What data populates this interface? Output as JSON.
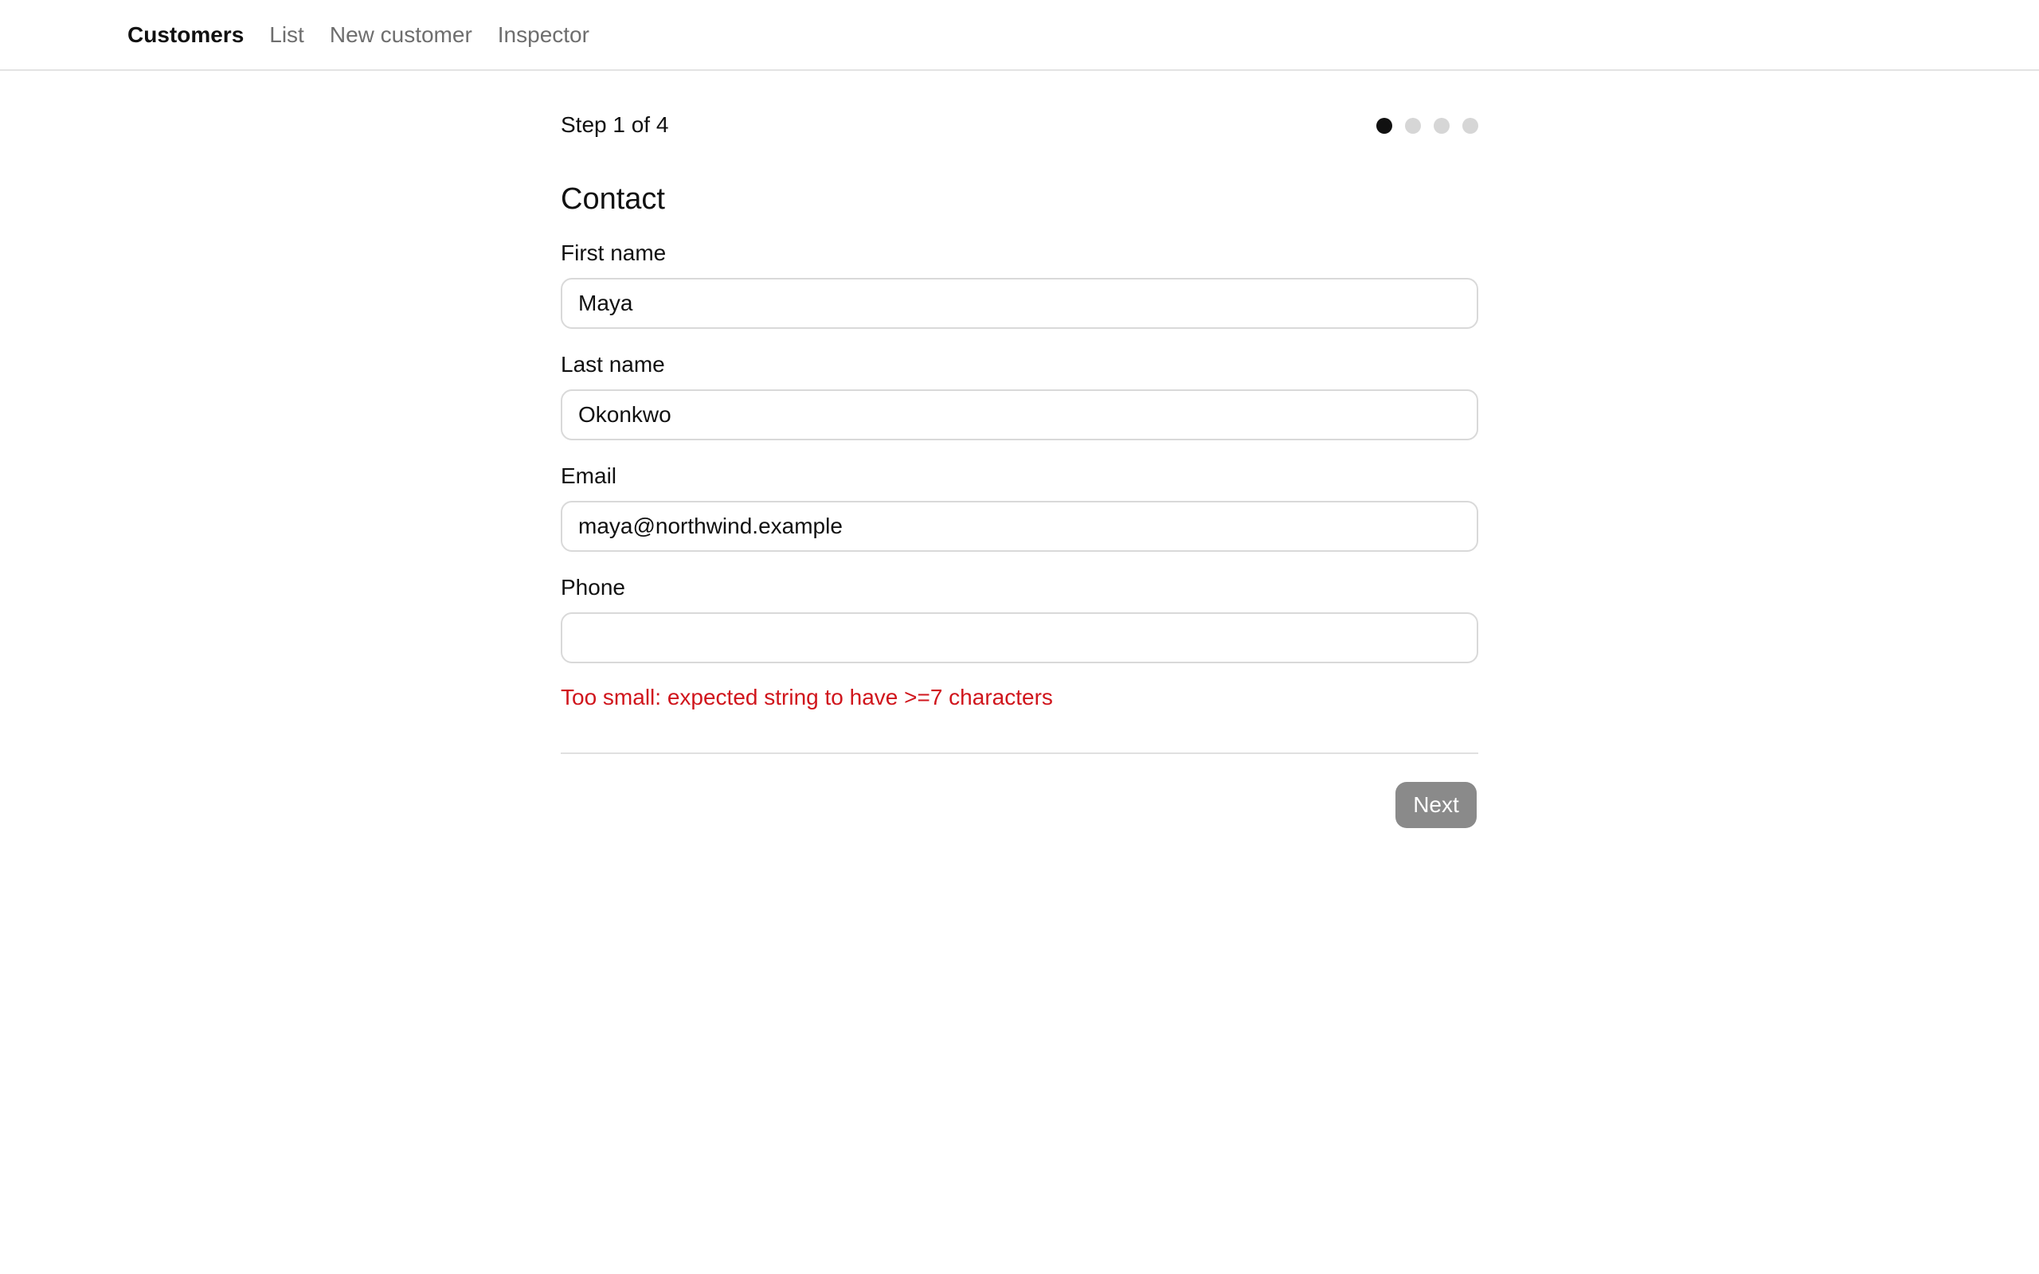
{
  "nav": {
    "brand": "Customers",
    "links": [
      "List",
      "New customer",
      "Inspector"
    ]
  },
  "wizard": {
    "step_label": "Step 1 of 4",
    "steps_total": 4,
    "current_step": 1,
    "section_title": "Contact",
    "fields": {
      "first_name": {
        "label": "First name",
        "value": "Maya"
      },
      "last_name": {
        "label": "Last name",
        "value": "Okonkwo"
      },
      "email": {
        "label": "Email",
        "value": "maya@northwind.example"
      },
      "phone": {
        "label": "Phone",
        "value": ""
      }
    },
    "error": "Too small: expected string to have >=7 characters",
    "next_label": "Next"
  },
  "colors": {
    "error": "#d0151c",
    "dot_active": "#111111",
    "dot_inactive": "#d6d6d6",
    "button_disabled": "#8a8a8a"
  }
}
